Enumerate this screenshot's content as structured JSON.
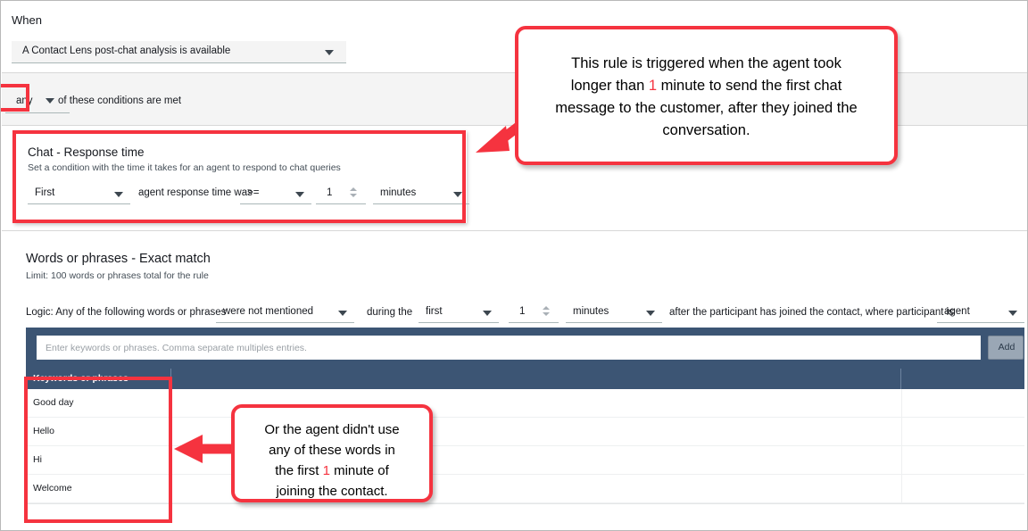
{
  "when_section": {
    "label": "When",
    "trigger_select": {
      "value": "A Contact Lens post-chat analysis is available",
      "icon": "chevron-down-icon"
    }
  },
  "conditions_section": {
    "match_select": {
      "value": "any"
    },
    "suffix_text": "of these conditions are met"
  },
  "chat_condition": {
    "title": "Chat - Response time",
    "subtitle": "Set a condition with the time it takes for an agent to respond to chat queries",
    "occurrence_select": "First",
    "middle_label": "agent response time was",
    "operator_select": ">=",
    "amount_value": "1",
    "unit_select": "minutes"
  },
  "words_section": {
    "title": "Words or phrases - Exact match",
    "subtitle": "Limit: 100 words or phrases total for the rule",
    "logic_prefix": "Logic: Any of the following words or phrases",
    "mention_select": "were not mentioned",
    "during_label": "during the",
    "order_select": "first",
    "amount_value": "1",
    "unit_select": "minutes",
    "after_label": "after the participant has joined the contact, where participant is",
    "participant_select": "agent",
    "keyword_input": {
      "value": "",
      "placeholder": "Enter keywords or phrases. Comma separate multiples entries."
    },
    "add_button": "Add",
    "table": {
      "columns": [
        "Keywords or phrases",
        "",
        ""
      ],
      "rows": [
        "Good day",
        "Hello",
        "Hi",
        "Welcome"
      ]
    }
  },
  "annotations": {
    "callout_1": {
      "lines": [
        "This rule is triggered when the agent took",
        "longer than 1 minute to send the first chat",
        "message to the customer, after they joined the",
        "conversation."
      ],
      "highlight_number": "1"
    },
    "callout_2": {
      "lines": [
        "Or the agent didn't use",
        "any of these words in",
        "the first 1 minute of",
        "joining the contact."
      ],
      "highlight_number": "1"
    }
  },
  "colors": {
    "annotation_red": "#f5333f",
    "table_header_navy": "#3c5574",
    "band_grey": "#f4f4f4",
    "text_dark": "#16191f"
  }
}
